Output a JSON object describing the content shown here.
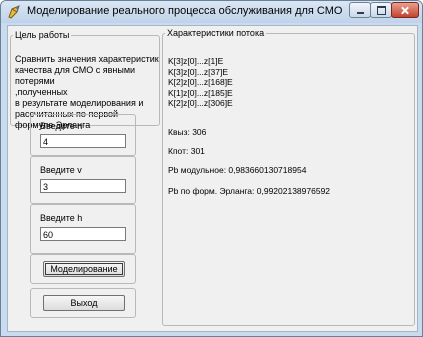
{
  "window": {
    "title": "Моделирование реального процесса обслуживания для СМО с явными потер..."
  },
  "goal": {
    "legend": "Цель работы",
    "text": "  Сравнить значения характеристик\nкачества для СМО с явными потерями\n,полученных\nв результате моделирования и\nрассчитанных по первой\nформуле Эрланга"
  },
  "inputs": {
    "n": {
      "label": "Введите n",
      "value": "4"
    },
    "v": {
      "label": "Введите v",
      "value": "3"
    },
    "h": {
      "label": "Введите h",
      "value": "60"
    }
  },
  "buttons": {
    "simulate": "Моделирование",
    "exit": "Выход"
  },
  "results": {
    "legend": "Характеристики потока",
    "lines": [
      "K[3]z[0]...z[1]E",
      "K[3]z[0]...z[37]E",
      "K[2]z[0]...z[168]E",
      "K[1]z[0]...z[185]E",
      "K[2]z[0]...z[306]E"
    ],
    "kvyz": "Квыз: 306",
    "kpot": "Кпот: 301",
    "pb_model": "Pb модульное: 0,983660130718954",
    "pb_erlang": "Pb по форм. Эрланга: 0,99202138976592"
  }
}
